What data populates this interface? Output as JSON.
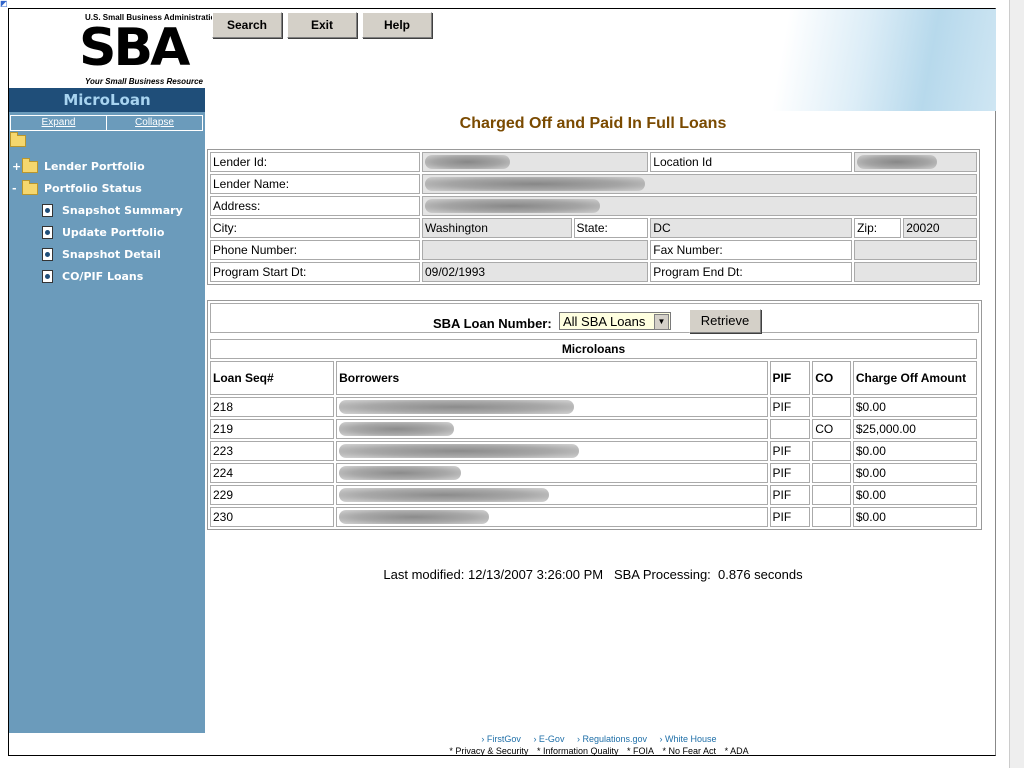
{
  "logo": {
    "agency": "U.S. Small Business Administration",
    "mark": "SBA",
    "tagline": "Your Small Business Resource"
  },
  "sidebar": {
    "title": "MicroLoan",
    "expand": "Expand",
    "collapse": "Collapse",
    "items": [
      {
        "label": "Lender Portfolio",
        "toggle": "+"
      },
      {
        "label": "Portfolio Status",
        "toggle": "-"
      },
      {
        "label": "Snapshot Summary"
      },
      {
        "label": "Update Portfolio"
      },
      {
        "label": "Snapshot Detail"
      },
      {
        "label": "CO/PIF Loans"
      }
    ]
  },
  "toolbar": {
    "search": "Search",
    "exit": "Exit",
    "help": "Help"
  },
  "page_title": "Charged Off and Paid In Full Loans",
  "info": {
    "lender_id_label": "Lender Id:",
    "location_id_label": "Location Id",
    "lender_name_label": "Lender Name:",
    "address_label": "Address:",
    "city_label": "City:",
    "city_value": "Washington",
    "state_label": "State:",
    "state_value": "DC",
    "zip_label": "Zip:",
    "zip_value": "20020",
    "phone_label": "Phone Number:",
    "fax_label": "Fax Number:",
    "start_label": "Program Start Dt:",
    "start_value": "09/02/1993",
    "end_label": "Program End Dt:"
  },
  "loan_selector": {
    "label": "SBA Loan Number:",
    "selected": "All SBA Loans",
    "retrieve": "Retrieve"
  },
  "microloans": {
    "caption": "Microloans",
    "headers": [
      "Loan Seq#",
      "Borrowers",
      "PIF",
      "CO",
      "Charge Off Amount"
    ],
    "rows": [
      {
        "seq": "218",
        "pif": "PIF",
        "co": "",
        "amount": "$0.00"
      },
      {
        "seq": "219",
        "pif": "",
        "co": "CO",
        "amount": "$25,000.00"
      },
      {
        "seq": "223",
        "pif": "PIF",
        "co": "",
        "amount": "$0.00"
      },
      {
        "seq": "224",
        "pif": "PIF",
        "co": "",
        "amount": "$0.00"
      },
      {
        "seq": "229",
        "pif": "PIF",
        "co": "",
        "amount": "$0.00"
      },
      {
        "seq": "230",
        "pif": "PIF",
        "co": "",
        "amount": "$0.00"
      }
    ]
  },
  "status": "Last modified: 12/13/2007 3:26:00 PM   SBA Processing:  0.876 seconds",
  "footer": {
    "links": [
      "› FirstGov",
      "› E-Gov",
      "› Regulations.gov",
      "› White House"
    ],
    "links2": [
      "* Privacy & Security",
      "* Information Quality",
      "* FOIA",
      "* No Fear Act",
      "* ADA"
    ]
  }
}
